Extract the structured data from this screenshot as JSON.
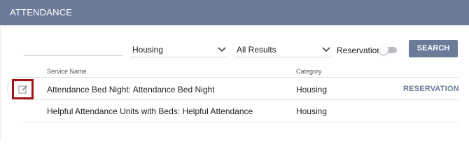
{
  "header": {
    "title": "ATTENDANCE"
  },
  "filters": {
    "category": {
      "selected": "Housing"
    },
    "results": {
      "selected": "All Results"
    },
    "reservation_toggle": {
      "label": "Reservation",
      "on": false
    },
    "search_label": "SEARCH"
  },
  "table": {
    "columns": [
      "Service Name",
      "Category"
    ],
    "rows": [
      {
        "service_name": "Attendance Bed Night: Attendance Bed Night",
        "category": "Housing",
        "action": "RESERVATION"
      },
      {
        "service_name": "Helpful Attendance Units with Beds: Helpful Attendance",
        "category": "Housing",
        "action": ""
      }
    ]
  },
  "colors": {
    "header": "#6b7a99",
    "highlight": "#a31515"
  },
  "icons": {
    "edit": "edit-icon",
    "chevron": "chevron-down-icon"
  }
}
